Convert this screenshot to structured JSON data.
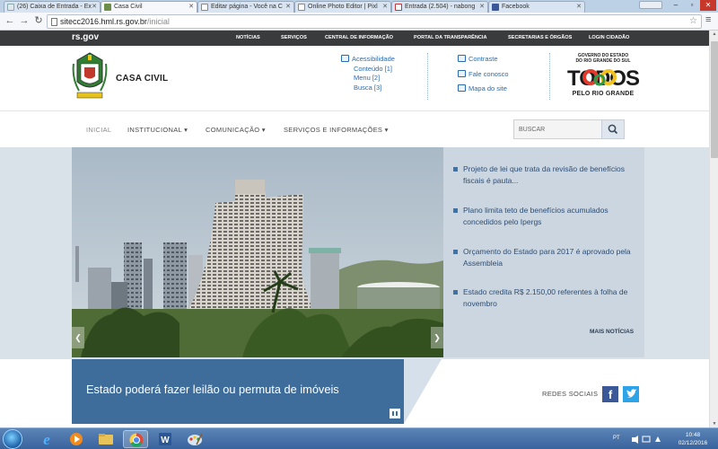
{
  "browser": {
    "tabs": [
      {
        "title": "(26) Caixa de Entrada - Ex",
        "icon": "page-icon",
        "active": false
      },
      {
        "title": "Casa Civil",
        "icon": "coat-of-arms-icon",
        "active": true
      },
      {
        "title": "Editar página - Você na C",
        "icon": "page-icon",
        "active": false
      },
      {
        "title": "Online Photo Editor | Pixl",
        "icon": "page-icon",
        "active": false
      },
      {
        "title": "Entrada (2.504) - nabong",
        "icon": "gmail-icon",
        "active": false
      },
      {
        "title": "Facebook",
        "icon": "facebook-icon",
        "active": false
      }
    ],
    "user_label": "",
    "url_domain": "sitecc2016.hml.rs.gov.br",
    "url_path": "/inicial"
  },
  "govbar": {
    "logo": "rs.gov",
    "links": [
      "NOTÍCIAS",
      "SERVIÇOS",
      "CENTRAL DE INFORMAÇÃO",
      "PORTAL DA TRANSPARÊNCIA",
      "SECRETARIAS E ÓRGÃOS",
      "LOGIN CIDADÃO"
    ]
  },
  "header": {
    "title": "CASA CIVIL",
    "accessibility": {
      "label": "Acessibilidade",
      "links": [
        "Conteúdo [1]",
        "Menu [2]",
        "Busca [3]"
      ]
    },
    "tools": [
      "Contraste",
      "Fale conosco",
      "Mapa do site"
    ],
    "gov_rs": {
      "line1": "GOVERNO DO ESTADO",
      "line2": "DO RIO GRANDE DO SUL",
      "todos": "TODOS",
      "pelo": "PELO RIO GRANDE"
    }
  },
  "nav": {
    "items": [
      {
        "label": "INICIAL",
        "caret": ""
      },
      {
        "label": "INSTITUCIONAL",
        "caret": "▾"
      },
      {
        "label": "COMUNICAÇÃO",
        "caret": "▾"
      },
      {
        "label": "SERVIÇOS E INFORMAÇÕES",
        "caret": "▾"
      }
    ],
    "search_placeholder": "BUSCAR"
  },
  "news": {
    "items": [
      "Projeto de lei que trata da revisão de benefícios fiscais é pauta...",
      "Plano limita teto de benefícios acumulados concedidos pelo Ipergs",
      "Orçamento do Estado para 2017 é aprovado pela Assembleia",
      "Estado credita R$ 2.150,00 referentes à folha de novembro"
    ],
    "more": "MAIS NOTÍCIAS"
  },
  "featured": {
    "title": "Estado poderá fazer leilão ou permuta de imóveis"
  },
  "social": {
    "label": "REDES SOCIAIS"
  },
  "taskbar": {
    "lang": "PT",
    "time": "10:48",
    "date": "02/12/2016"
  },
  "colors": {
    "govbar": "#3a3b3d",
    "link_blue": "#2b6cb0",
    "news_text": "#2c4e74",
    "featured_bg": "#3f6d9b",
    "facebook": "#3b5998",
    "twitter": "#2ea4e8"
  }
}
